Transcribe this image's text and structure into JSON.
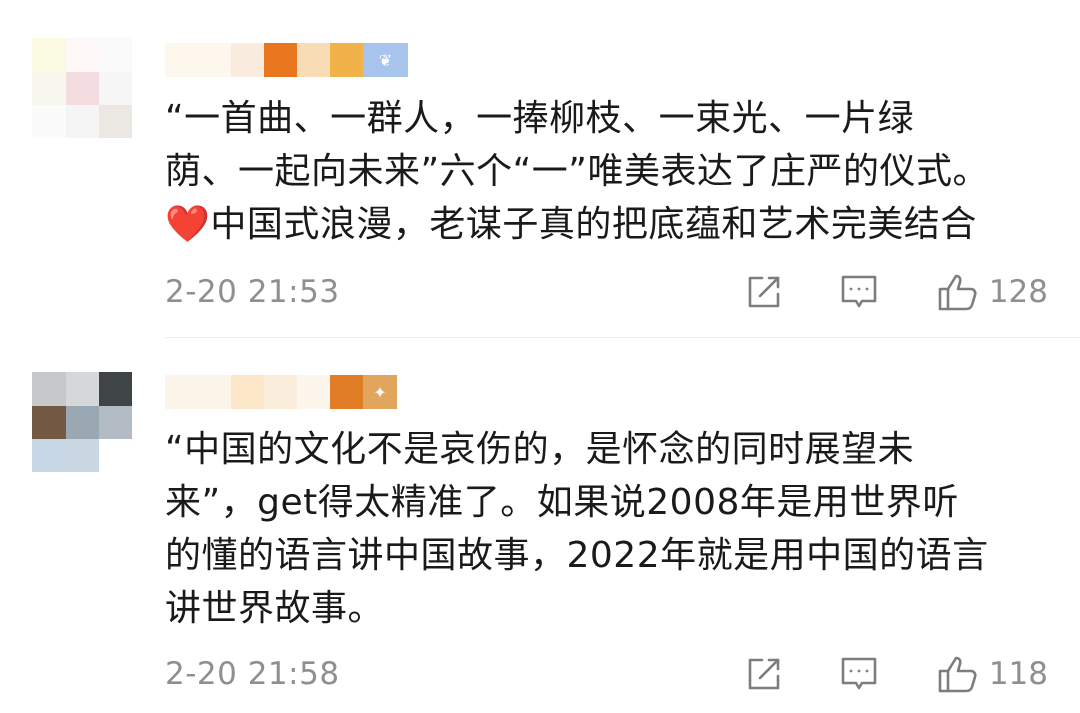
{
  "comments": [
    {
      "text_lines": [
        "“一首曲、一群人，一捧柳枝、一束光、一片绿",
        "荫、一起向未来”六个“一”唯美表达了庄严的仪式。",
        "中国式浪漫，老谋子真的把底蕴和艺术完美结合"
      ],
      "time": "2-20 21:53",
      "likes": "128",
      "emoji": "❤️"
    },
    {
      "text_lines": [
        "“中国的文化不是哀伤的，是怀念的同时展望未",
        "来”，get得太精准了。如果说2008年是用世界听",
        "的懂的语言讲中国故事，2022年就是用中国的语言",
        "讲世界故事。"
      ],
      "time": "2-20 21:58",
      "likes": "118"
    }
  ],
  "icons": {
    "share": "share-icon",
    "reply": "reply-icon",
    "like": "thumbs-up-icon",
    "heart": "red-heart-emoji"
  },
  "colors": {
    "meta_text": "#8f8f8f",
    "body_text": "#1a1a1a",
    "heart": "#e0383e"
  }
}
